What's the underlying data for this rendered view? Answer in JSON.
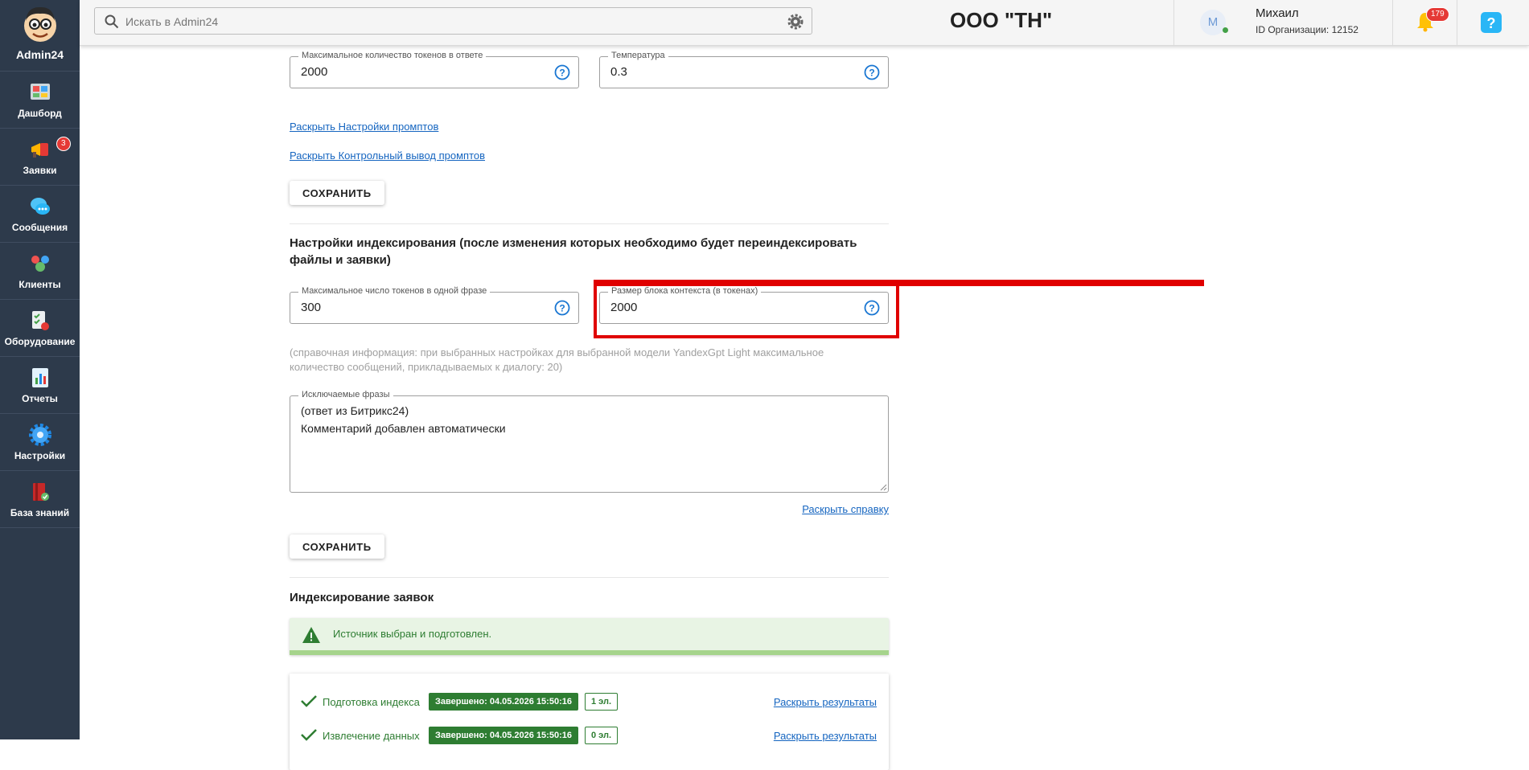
{
  "app": {
    "name": "Admin24"
  },
  "sidebar": {
    "items": [
      {
        "label": "Дашборд",
        "icon": "dashboard-icon"
      },
      {
        "label": "Заявки",
        "icon": "megaphone-icon",
        "badge": "3"
      },
      {
        "label": "Сообщения",
        "icon": "chat-icon"
      },
      {
        "label": "Клиенты",
        "icon": "clients-icon"
      },
      {
        "label": "Оборудование",
        "icon": "equipment-icon"
      },
      {
        "label": "Отчеты",
        "icon": "reports-icon"
      },
      {
        "label": "Настройки",
        "icon": "gear-icon"
      },
      {
        "label": "База знаний",
        "icon": "knowledge-base-icon"
      }
    ]
  },
  "header": {
    "search_placeholder": "Искать в Admin24",
    "org_title": "ООО \"ТН\"",
    "user_initial": "M",
    "user_name": "Михаил",
    "user_org": "ID Организации: 12152",
    "notifications_count": "179"
  },
  "main": {
    "max_tokens_label": "Максимальное количество токенов в ответе",
    "max_tokens_value": "2000",
    "temperature_label": "Температура",
    "temperature_value": "0.3",
    "expand_prompt_settings": "Раскрыть Настройки промптов",
    "expand_prompt_output": "Раскрыть Контрольный вывод промптов",
    "save_label": "СОХРАНИТЬ",
    "indexing_title": "Настройки индексирования (после изменения которых необходимо будет переиндексировать файлы и заявки)",
    "max_phrase_tokens_label": "Максимальное число токенов в одной фразе",
    "max_phrase_tokens_value": "300",
    "context_block_label": "Размер блока контекста (в токенах)",
    "context_block_value": "2000",
    "reference_info": "(справочная информация: при выбранных настройках для выбранной модели YandexGpt Light максимальное количество сообщений, прикладываемых к диалогу: 20)",
    "excluded_phrases_label": "Исключаемые фразы",
    "excluded_phrases_lines": [
      "(ответ из Битрикс24)",
      "Комментарий добавлен автоматически"
    ],
    "expand_help": "Раскрыть справку",
    "save_label_2": "СОХРАНИТЬ",
    "ticket_indexing_title": "Индексирование заявок",
    "source_status": "Источник выбран и подготовлен.",
    "steps": [
      {
        "label": "Подготовка индекса",
        "status": "Завершено: 04.05.2026 15:50:16",
        "count": "1 эл.",
        "link": "Раскрыть результаты"
      },
      {
        "label": "Извлечение данных",
        "status": "Завершено: 04.05.2026 15:50:16",
        "count": "0 эл.",
        "link": "Раскрыть результаты"
      }
    ]
  },
  "colors": {
    "sidebar_bg": "#2d3a4b",
    "highlight": "#e00000",
    "success": "#2e7d32",
    "link": "#1565c0"
  }
}
